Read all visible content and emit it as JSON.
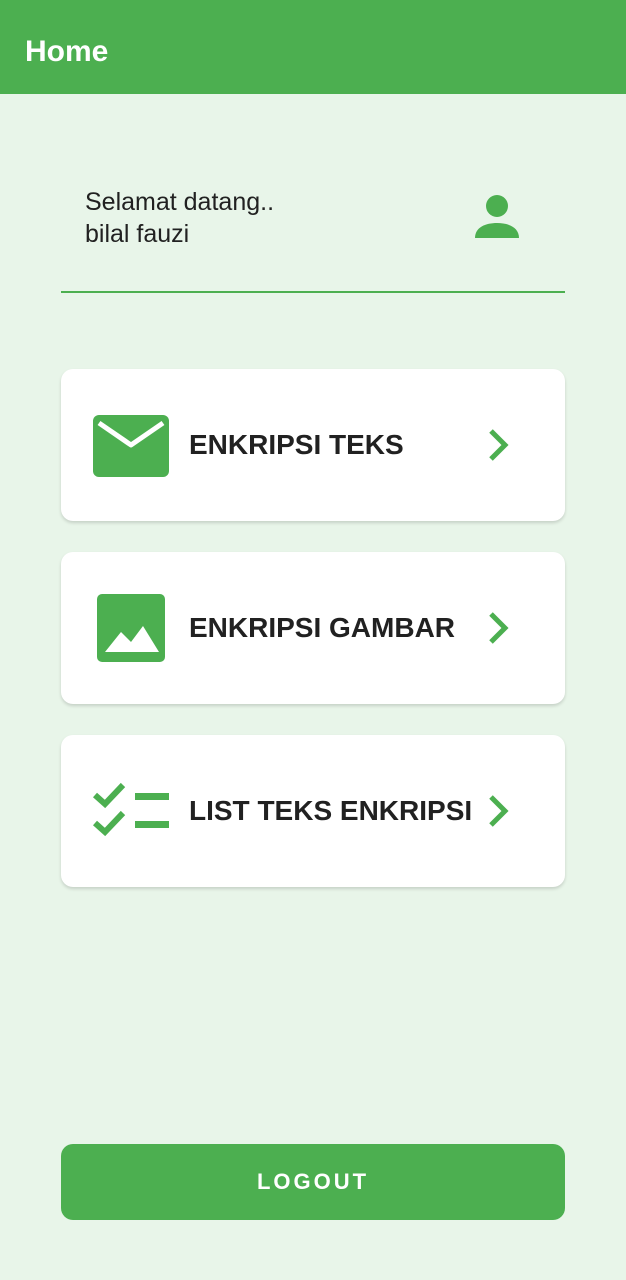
{
  "appbar": {
    "title": "Home",
    "color": "#4caf50"
  },
  "welcome": {
    "greeting": "Selamat datang..",
    "username": "bilal fauzi",
    "icon": "account-icon"
  },
  "menu": [
    {
      "label": "ENKRIPSI TEKS",
      "icon": "mail-icon"
    },
    {
      "label": "ENKRIPSI GAMBAR",
      "icon": "image-icon"
    },
    {
      "label": "LIST TEKS ENKRIPSI",
      "icon": "checklist-icon"
    }
  ],
  "logout": {
    "label": "LOGOUT"
  },
  "colors": {
    "accent": "#4caf50",
    "background": "#e8f5e9",
    "card": "#ffffff",
    "text": "#212121"
  }
}
